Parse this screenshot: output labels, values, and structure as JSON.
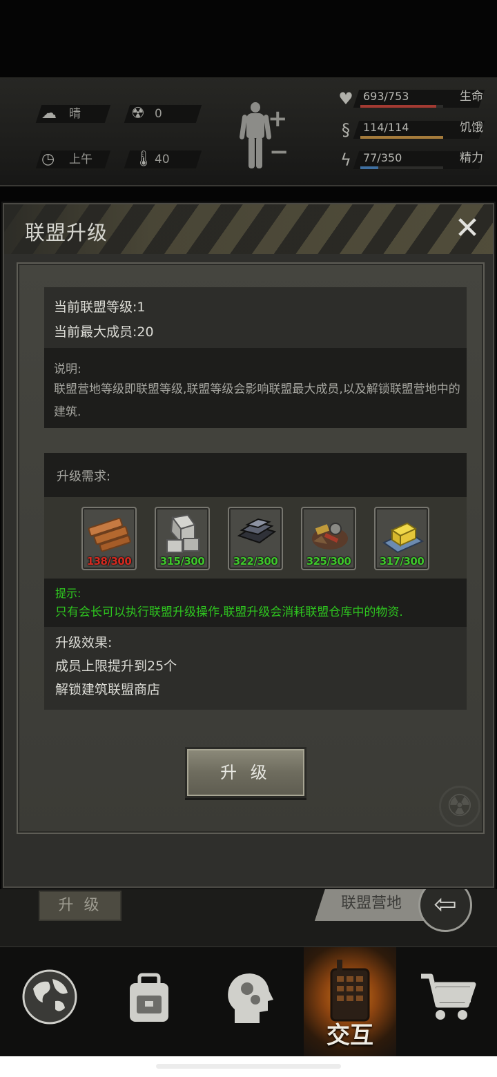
{
  "hud": {
    "weather": {
      "icon": "cloud-sun-icon",
      "value": "晴"
    },
    "radiation": {
      "icon": "radiation-icon",
      "value": "0"
    },
    "time": {
      "icon": "clock-icon",
      "value": "上午"
    },
    "temperature": {
      "icon": "thermometer-icon",
      "value": "40"
    },
    "stats": [
      {
        "icon": "heart-icon",
        "value": "693/753",
        "label": "生命",
        "level": 0.92,
        "color": "#a33a32"
      },
      {
        "icon": "stomach-icon",
        "value": "114/114",
        "label": "饥饿",
        "level": 1.0,
        "color": "#a57b3b"
      },
      {
        "icon": "energy-icon",
        "value": "77/350",
        "label": "精力",
        "level": 0.22,
        "color": "#3f6fa0"
      }
    ]
  },
  "dialog": {
    "title": "联盟升级",
    "info": {
      "level_line": "当前联盟等级:1",
      "members_line": "当前最大成员:20",
      "desc_title": "说明:",
      "desc_text": "联盟营地等级即联盟等级,联盟等级会影响联盟最大成员,以及解锁联盟营地中的建筑."
    },
    "requirements": {
      "title": "升级需求:",
      "items": [
        {
          "name": "wood-planks-icon",
          "count": "138/300",
          "color": "#d42a20"
        },
        {
          "name": "stone-blocks-icon",
          "count": "315/300",
          "color": "#3fc72c"
        },
        {
          "name": "metal-ingots-icon",
          "count": "322/300",
          "color": "#3fc72c"
        },
        {
          "name": "scrap-parts-icon",
          "count": "325/300",
          "color": "#3fc72c"
        },
        {
          "name": "cheese-food-icon",
          "count": "317/300",
          "color": "#3fc72c"
        }
      ]
    },
    "tip": {
      "title": "提示:",
      "text": "只有会长可以执行联盟升级操作,联盟升级会消耗联盟仓库中的物资."
    },
    "effects": {
      "title": "升级效果:",
      "lines": [
        "成员上限提升到25个",
        "解锁建筑联盟商店"
      ]
    },
    "upgrade_button": "升 级"
  },
  "background": {
    "upgrade_button": "升 级",
    "camp_button": "联盟营地"
  },
  "tabbar": {
    "tabs": [
      {
        "name": "globe-icon",
        "label": ""
      },
      {
        "name": "backpack-icon",
        "label": ""
      },
      {
        "name": "skills-head-icon",
        "label": ""
      },
      {
        "name": "walkie-talkie-icon",
        "label": "交互",
        "active": true
      },
      {
        "name": "cart-icon",
        "label": ""
      }
    ]
  }
}
